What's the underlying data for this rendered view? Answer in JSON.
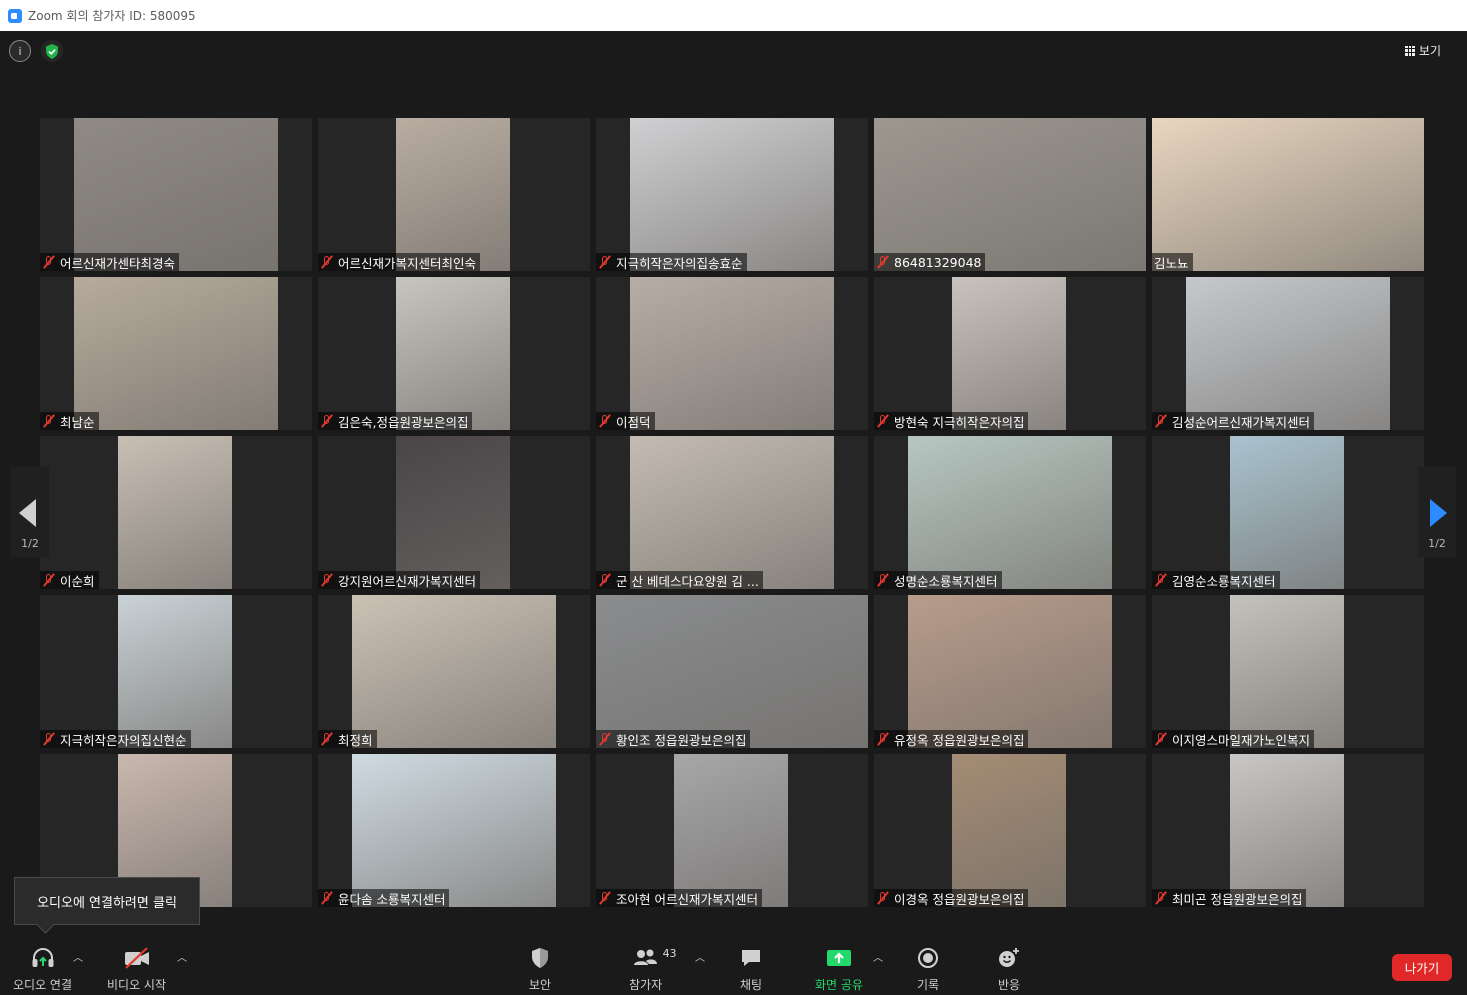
{
  "window": {
    "title": "Zoom 회의 참가자 ID: 580095"
  },
  "topbar": {
    "view_label": "보기"
  },
  "pagination": {
    "left_label": "1/2",
    "right_label": "1/2"
  },
  "tiles": [
    {
      "name": "어르신재가센타최경숙",
      "muted": true,
      "feed_color": "#8f8a86"
    },
    {
      "name": "어르신재가복지센터최인숙",
      "muted": true,
      "feed_color": "#b9ada1"
    },
    {
      "name": "지극히작은자의집송효순",
      "muted": true,
      "feed_color": "#cfd0d2"
    },
    {
      "name": "86481329048",
      "muted": true,
      "feed_color": "#9c9890"
    },
    {
      "name": "김노뇨",
      "muted": false,
      "feed_color": "#e8d6bf",
      "active": true
    },
    {
      "name": "최남순",
      "muted": true,
      "feed_color": "#b6ab9c"
    },
    {
      "name": "김은숙,정읍원광보은의집",
      "muted": true,
      "feed_color": "#c8c4bf"
    },
    {
      "name": "이점덕",
      "muted": true,
      "feed_color": "#b8ada6"
    },
    {
      "name": "방현숙 지극히작은자의집",
      "muted": true,
      "feed_color": "#c9c3bd"
    },
    {
      "name": "김성순어르신재가복지센터",
      "muted": true,
      "feed_color": "#c5c9cd"
    },
    {
      "name": "이순희",
      "muted": true,
      "feed_color": "#c8bfb4"
    },
    {
      "name": "강지원어르신재가복지센터",
      "muted": true,
      "feed_color": "#4a4548"
    },
    {
      "name": "군 산 베데스다요양원  김 ...",
      "muted": true,
      "feed_color": "#c4bcb3"
    },
    {
      "name": "성명순소룡복지센터",
      "muted": true,
      "feed_color": "#b7c7c1"
    },
    {
      "name": "김영순소룡복지센터",
      "muted": true,
      "feed_color": "#a9c3cf"
    },
    {
      "name": "지극히작은자의집신현순",
      "muted": true,
      "feed_color": "#c9d2d6"
    },
    {
      "name": "최정희",
      "muted": true,
      "feed_color": "#cbc2b5"
    },
    {
      "name": "황인조 정읍원광보은의집",
      "muted": true,
      "feed_color": "#8a8c8e"
    },
    {
      "name": "유정옥 정읍원광보은의집",
      "muted": true,
      "feed_color": "#b89c8b"
    },
    {
      "name": "이지영스마일재가노인복지",
      "muted": true,
      "feed_color": "#c4c2bd"
    },
    {
      "name": "",
      "muted": false,
      "feed_color": "#c9b8ae"
    },
    {
      "name": "윤다솜 소룡복지센터",
      "muted": true,
      "feed_color": "#cfdbe2"
    },
    {
      "name": "조아현 어르신재가복지센터",
      "muted": true,
      "feed_color": "#a7a7a9"
    },
    {
      "name": "이경옥 정읍원광보은의집",
      "muted": true,
      "feed_color": "#a48c74"
    },
    {
      "name": "최미곤 정읍원광보은의집",
      "muted": true,
      "feed_color": "#c8c7c6"
    }
  ],
  "tooltip": {
    "text": "오디오에 연결하려면 클릭"
  },
  "toolbar": {
    "audio_label": "오디오 연결",
    "video_label": "비디오 시작",
    "security_label": "보안",
    "participants_label": "참가자",
    "participants_count": "43",
    "chat_label": "채팅",
    "share_label": "화면 공유",
    "record_label": "기록",
    "reactions_label": "반응",
    "leave_label": "나가기"
  },
  "colors": {
    "accent": "#2d8cff",
    "share_green": "#23d96b",
    "leave_red": "#e02828",
    "active_speaker": "#d7e46a"
  }
}
